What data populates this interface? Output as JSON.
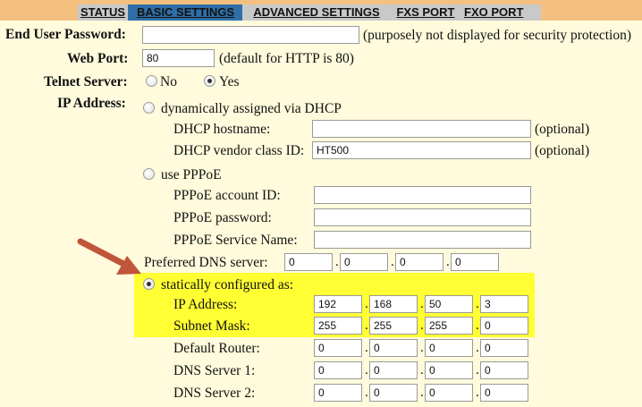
{
  "tabs": [
    {
      "label": "STATUS",
      "active": false
    },
    {
      "label": "BASIC SETTINGS",
      "active": true
    },
    {
      "label": "ADVANCED SETTINGS",
      "active": false
    },
    {
      "label": "FXS PORT",
      "active": false
    },
    {
      "label": "FXO PORT",
      "active": false
    }
  ],
  "end_user_password": {
    "label": "End User Password:",
    "value": "",
    "note": "(purposely not displayed for security protection)"
  },
  "web_port": {
    "label": "Web Port:",
    "value": "80",
    "note": "(default for HTTP is 80)"
  },
  "telnet_server": {
    "label": "Telnet Server:",
    "options": [
      {
        "label": "No",
        "selected": false
      },
      {
        "label": "Yes",
        "selected": true
      }
    ]
  },
  "ip_address": {
    "label": "IP Address:",
    "dhcp": {
      "label": "dynamically assigned via DHCP",
      "selected": false,
      "hostname": {
        "label": "DHCP hostname:",
        "value": "",
        "note": "(optional)"
      },
      "vendor_class": {
        "label": "DHCP vendor class ID:",
        "value": "HT500",
        "note": "(optional)"
      }
    },
    "pppoe": {
      "label": "use PPPoE",
      "selected": false,
      "account_id": {
        "label": "PPPoE account ID:",
        "value": ""
      },
      "password": {
        "label": "PPPoE password:",
        "value": ""
      },
      "service_name": {
        "label": "PPPoE Service Name:",
        "value": ""
      }
    },
    "preferred_dns": {
      "label": "Preferred DNS server:",
      "octets": [
        "0",
        "0",
        "0",
        "0"
      ]
    },
    "static": {
      "label": "statically configured as:",
      "selected": true,
      "ip": {
        "label": "IP Address:",
        "octets": [
          "192",
          "168",
          "50",
          "3"
        ]
      },
      "subnet": {
        "label": "Subnet Mask:",
        "octets": [
          "255",
          "255",
          "255",
          "0"
        ]
      },
      "router": {
        "label": "Default Router:",
        "octets": [
          "0",
          "0",
          "0",
          "0"
        ]
      },
      "dns1": {
        "label": "DNS Server 1:",
        "octets": [
          "0",
          "0",
          "0",
          "0"
        ]
      },
      "dns2": {
        "label": "DNS Server 2:",
        "octets": [
          "0",
          "0",
          "0",
          "0"
        ]
      }
    }
  },
  "colors": {
    "header": "#f3c07f",
    "tabs": "#c9c9c9",
    "active_tab": "#2f6fa8",
    "page": "#fffbdc",
    "highlight": "#ffff33",
    "arrow": "#c0553a"
  }
}
